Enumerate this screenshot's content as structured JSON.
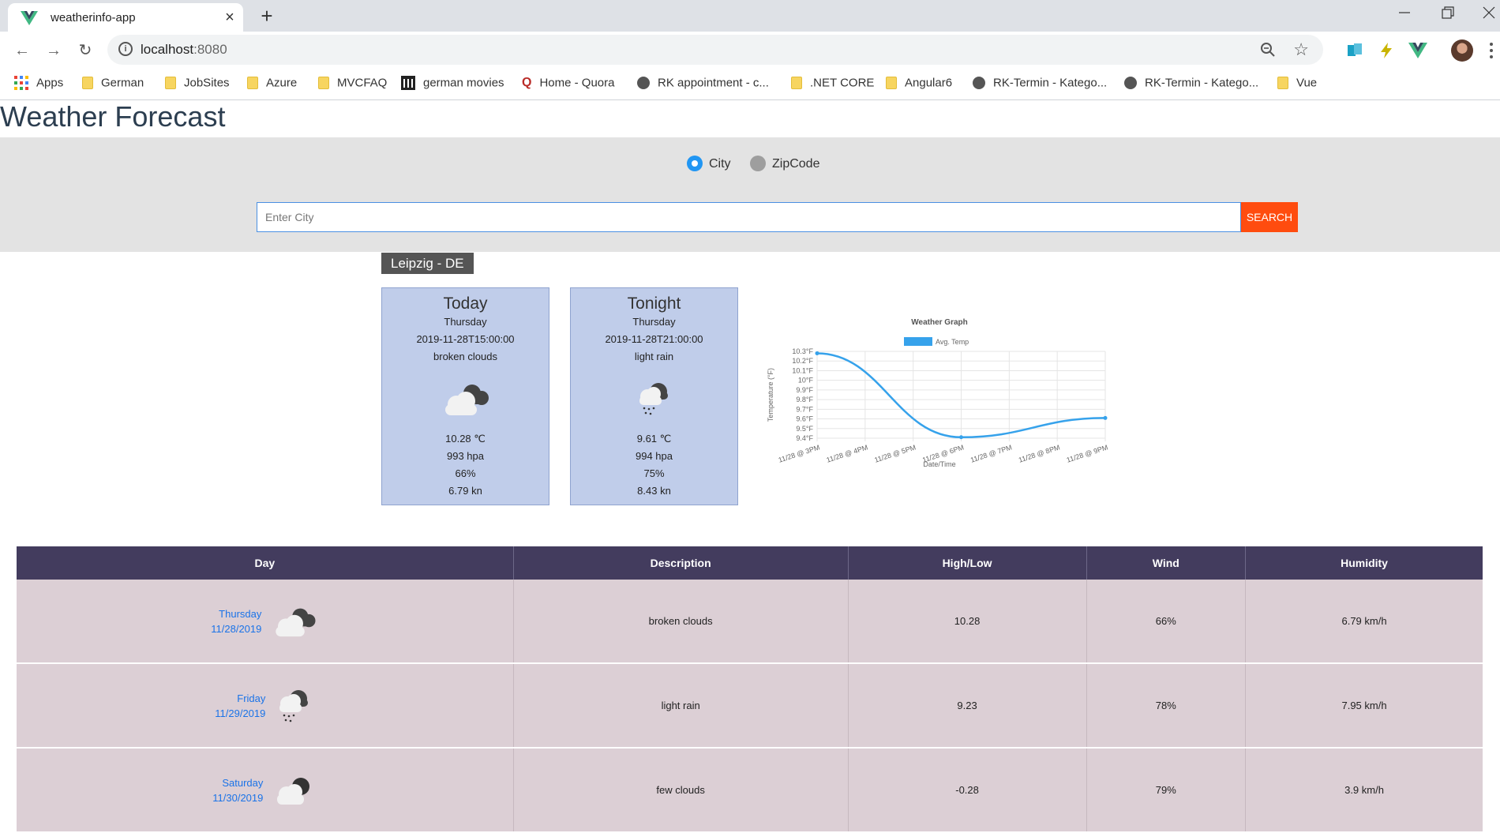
{
  "browser": {
    "tab_title": "weatherinfo-app",
    "url_host": "localhost",
    "url_port": ":8080",
    "bookmarks": [
      {
        "label": "Apps",
        "icon": "apps-grid-icon"
      },
      {
        "label": "German",
        "icon": "folder-icon"
      },
      {
        "label": "JobSites",
        "icon": "folder-icon"
      },
      {
        "label": "Azure",
        "icon": "folder-icon"
      },
      {
        "label": "MVCFAQ",
        "icon": "folder-icon"
      },
      {
        "label": "german movies",
        "icon": "building-icon"
      },
      {
        "label": "Home - Quora",
        "icon": "quora-icon"
      },
      {
        "label": "RK appointment - c...",
        "icon": "globe-icon"
      },
      {
        "label": ".NET CORE",
        "icon": "folder-icon"
      },
      {
        "label": "Angular6",
        "icon": "folder-icon"
      },
      {
        "label": "RK-Termin - Katego...",
        "icon": "globe-icon"
      },
      {
        "label": "RK-Termin - Katego...",
        "icon": "globe-icon"
      },
      {
        "label": "Vue",
        "icon": "folder-icon"
      }
    ]
  },
  "page": {
    "title": "Weather Forecast",
    "search": {
      "radio_city": "City",
      "radio_zip": "ZipCode",
      "selected": "City",
      "placeholder": "Enter City",
      "value": "",
      "button": "SEARCH"
    },
    "location": "Leipzig - DE",
    "cards": [
      {
        "title": "Today",
        "day": "Thursday",
        "datetime": "2019-11-28T15:00:00",
        "description": "broken clouds",
        "icon": "broken-clouds-icon",
        "temp": "10.28 ℃",
        "pressure": "993 hpa",
        "humidity": "66%",
        "wind": "6.79 kn"
      },
      {
        "title": "Tonight",
        "day": "Thursday",
        "datetime": "2019-11-28T21:00:00",
        "description": "light rain",
        "icon": "light-rain-icon",
        "temp": "9.61 ℃",
        "pressure": "994 hpa",
        "humidity": "75%",
        "wind": "8.43 kn"
      }
    ],
    "table": {
      "headers": [
        "Day",
        "Description",
        "High/Low",
        "Wind",
        "Humidity"
      ],
      "rows": [
        {
          "day": "Thursday",
          "date": "11/28/2019",
          "icon": "broken-clouds-icon",
          "description": "broken clouds",
          "highlow": "10.28",
          "wind": "66%",
          "humidity": "6.79 km/h"
        },
        {
          "day": "Friday",
          "date": "11/29/2019",
          "icon": "light-rain-icon",
          "description": "light rain",
          "highlow": "9.23",
          "wind": "78%",
          "humidity": "7.95 km/h"
        },
        {
          "day": "Saturday",
          "date": "11/30/2019",
          "icon": "few-clouds-icon",
          "description": "few clouds",
          "highlow": "-0.28",
          "wind": "79%",
          "humidity": "3.9 km/h"
        }
      ]
    }
  },
  "colors": {
    "accent": "#2196f3",
    "search_button": "#ff4c0f",
    "table_header": "#433c5e",
    "table_row": "#dccfd5",
    "card": "#c0cdea",
    "line": "#36a2eb"
  },
  "chart_data": {
    "type": "line",
    "title": "Weather Graph",
    "xlabel": "Date/Time",
    "ylabel": "Temperature (°F)",
    "legend": [
      "Avg. Temp"
    ],
    "legend_position": "top",
    "grid": true,
    "x": [
      "11/28 @ 3PM",
      "11/28 @ 4PM",
      "11/28 @ 5PM",
      "11/28 @ 6PM",
      "11/28 @ 7PM",
      "11/28 @ 8PM",
      "11/28 @ 9PM"
    ],
    "y_ticks": [
      "10.3°F",
      "10.2°F",
      "10.1°F",
      "10°F",
      "9.9°F",
      "9.8°F",
      "9.7°F",
      "9.6°F",
      "9.5°F",
      "9.4°F"
    ],
    "ylim": [
      9.4,
      10.3
    ],
    "series": [
      {
        "name": "Avg. Temp",
        "points": [
          {
            "x": "11/28 @ 3PM",
            "y": 10.28
          },
          {
            "x": "11/28 @ 6PM",
            "y": 9.41
          },
          {
            "x": "11/28 @ 9PM",
            "y": 9.61
          }
        ]
      }
    ]
  }
}
